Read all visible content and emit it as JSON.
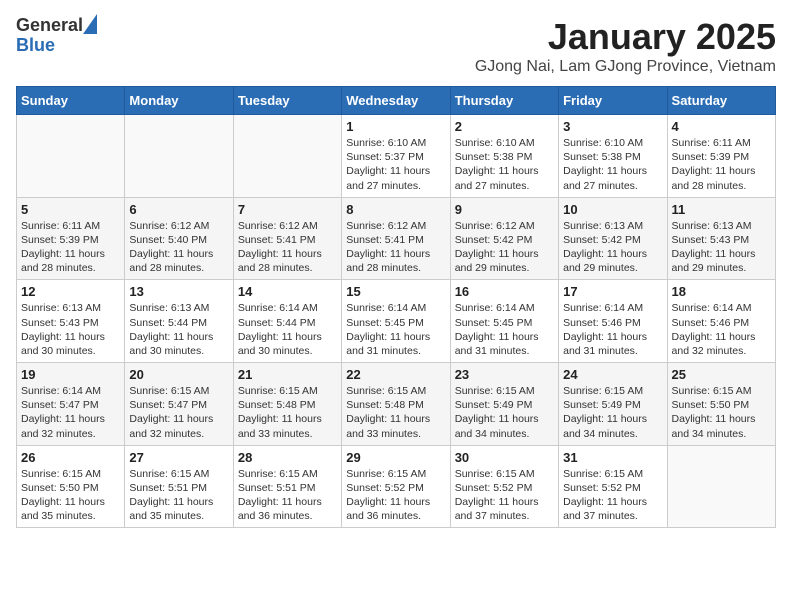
{
  "logo": {
    "general": "General",
    "blue": "Blue"
  },
  "title": "January 2025",
  "subtitle": "GJong Nai, Lam GJong Province, Vietnam",
  "weekdays": [
    "Sunday",
    "Monday",
    "Tuesday",
    "Wednesday",
    "Thursday",
    "Friday",
    "Saturday"
  ],
  "weeks": [
    [
      {
        "day": "",
        "info": ""
      },
      {
        "day": "",
        "info": ""
      },
      {
        "day": "",
        "info": ""
      },
      {
        "day": "1",
        "info": "Sunrise: 6:10 AM\nSunset: 5:37 PM\nDaylight: 11 hours and 27 minutes."
      },
      {
        "day": "2",
        "info": "Sunrise: 6:10 AM\nSunset: 5:38 PM\nDaylight: 11 hours and 27 minutes."
      },
      {
        "day": "3",
        "info": "Sunrise: 6:10 AM\nSunset: 5:38 PM\nDaylight: 11 hours and 27 minutes."
      },
      {
        "day": "4",
        "info": "Sunrise: 6:11 AM\nSunset: 5:39 PM\nDaylight: 11 hours and 28 minutes."
      }
    ],
    [
      {
        "day": "5",
        "info": "Sunrise: 6:11 AM\nSunset: 5:39 PM\nDaylight: 11 hours and 28 minutes."
      },
      {
        "day": "6",
        "info": "Sunrise: 6:12 AM\nSunset: 5:40 PM\nDaylight: 11 hours and 28 minutes."
      },
      {
        "day": "7",
        "info": "Sunrise: 6:12 AM\nSunset: 5:41 PM\nDaylight: 11 hours and 28 minutes."
      },
      {
        "day": "8",
        "info": "Sunrise: 6:12 AM\nSunset: 5:41 PM\nDaylight: 11 hours and 28 minutes."
      },
      {
        "day": "9",
        "info": "Sunrise: 6:12 AM\nSunset: 5:42 PM\nDaylight: 11 hours and 29 minutes."
      },
      {
        "day": "10",
        "info": "Sunrise: 6:13 AM\nSunset: 5:42 PM\nDaylight: 11 hours and 29 minutes."
      },
      {
        "day": "11",
        "info": "Sunrise: 6:13 AM\nSunset: 5:43 PM\nDaylight: 11 hours and 29 minutes."
      }
    ],
    [
      {
        "day": "12",
        "info": "Sunrise: 6:13 AM\nSunset: 5:43 PM\nDaylight: 11 hours and 30 minutes."
      },
      {
        "day": "13",
        "info": "Sunrise: 6:13 AM\nSunset: 5:44 PM\nDaylight: 11 hours and 30 minutes."
      },
      {
        "day": "14",
        "info": "Sunrise: 6:14 AM\nSunset: 5:44 PM\nDaylight: 11 hours and 30 minutes."
      },
      {
        "day": "15",
        "info": "Sunrise: 6:14 AM\nSunset: 5:45 PM\nDaylight: 11 hours and 31 minutes."
      },
      {
        "day": "16",
        "info": "Sunrise: 6:14 AM\nSunset: 5:45 PM\nDaylight: 11 hours and 31 minutes."
      },
      {
        "day": "17",
        "info": "Sunrise: 6:14 AM\nSunset: 5:46 PM\nDaylight: 11 hours and 31 minutes."
      },
      {
        "day": "18",
        "info": "Sunrise: 6:14 AM\nSunset: 5:46 PM\nDaylight: 11 hours and 32 minutes."
      }
    ],
    [
      {
        "day": "19",
        "info": "Sunrise: 6:14 AM\nSunset: 5:47 PM\nDaylight: 11 hours and 32 minutes."
      },
      {
        "day": "20",
        "info": "Sunrise: 6:15 AM\nSunset: 5:47 PM\nDaylight: 11 hours and 32 minutes."
      },
      {
        "day": "21",
        "info": "Sunrise: 6:15 AM\nSunset: 5:48 PM\nDaylight: 11 hours and 33 minutes."
      },
      {
        "day": "22",
        "info": "Sunrise: 6:15 AM\nSunset: 5:48 PM\nDaylight: 11 hours and 33 minutes."
      },
      {
        "day": "23",
        "info": "Sunrise: 6:15 AM\nSunset: 5:49 PM\nDaylight: 11 hours and 34 minutes."
      },
      {
        "day": "24",
        "info": "Sunrise: 6:15 AM\nSunset: 5:49 PM\nDaylight: 11 hours and 34 minutes."
      },
      {
        "day": "25",
        "info": "Sunrise: 6:15 AM\nSunset: 5:50 PM\nDaylight: 11 hours and 34 minutes."
      }
    ],
    [
      {
        "day": "26",
        "info": "Sunrise: 6:15 AM\nSunset: 5:50 PM\nDaylight: 11 hours and 35 minutes."
      },
      {
        "day": "27",
        "info": "Sunrise: 6:15 AM\nSunset: 5:51 PM\nDaylight: 11 hours and 35 minutes."
      },
      {
        "day": "28",
        "info": "Sunrise: 6:15 AM\nSunset: 5:51 PM\nDaylight: 11 hours and 36 minutes."
      },
      {
        "day": "29",
        "info": "Sunrise: 6:15 AM\nSunset: 5:52 PM\nDaylight: 11 hours and 36 minutes."
      },
      {
        "day": "30",
        "info": "Sunrise: 6:15 AM\nSunset: 5:52 PM\nDaylight: 11 hours and 37 minutes."
      },
      {
        "day": "31",
        "info": "Sunrise: 6:15 AM\nSunset: 5:52 PM\nDaylight: 11 hours and 37 minutes."
      },
      {
        "day": "",
        "info": ""
      }
    ]
  ]
}
